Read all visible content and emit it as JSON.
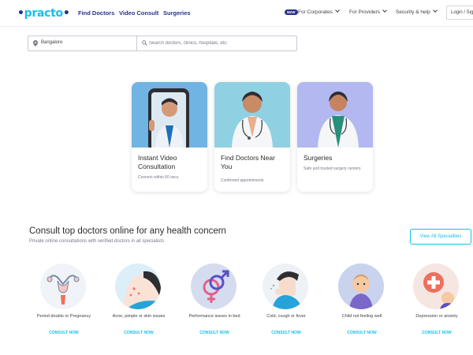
{
  "header": {
    "logo_text": "practo",
    "nav": [
      "Find Doctors",
      "Video Consult",
      "Surgeries"
    ],
    "new_badge": "NEW",
    "corporates": "For Corporates",
    "providers": "For Providers",
    "security": "Security & help",
    "login": "Login / Signup"
  },
  "search": {
    "location": "Bangalore",
    "query_placeholder": "Search doctors, clinics, hospitals, etc."
  },
  "cards": [
    {
      "title": "Instant Video Consultation",
      "subtitle": "Connect within 60 secs"
    },
    {
      "title": "Find Doctors Near You",
      "subtitle": "Confirmed appointments"
    },
    {
      "title": "Surgeries",
      "subtitle": "Safe and trusted surgery centers"
    }
  ],
  "consult": {
    "title": "Consult top doctors online for any health concern",
    "subtitle": "Private online consultations with verified doctors in all specialists",
    "view_all": "View All Specialities",
    "items": [
      {
        "label": "Period doubts or Pregnancy",
        "cta": "CONSULT NOW"
      },
      {
        "label": "Acne, pimple or skin issues",
        "cta": "CONSULT NOW"
      },
      {
        "label": "Performance issues in bed",
        "cta": "CONSULT NOW"
      },
      {
        "label": "Cold, cough or fever",
        "cta": "CONSULT NOW"
      },
      {
        "label": "Child not feeling well",
        "cta": "CONSULT NOW"
      },
      {
        "label": "Depression or anxiety",
        "cta": "CONSULT NOW"
      }
    ]
  },
  "colors": {
    "brand_blue": "#14bef0",
    "navy": "#28328c"
  }
}
